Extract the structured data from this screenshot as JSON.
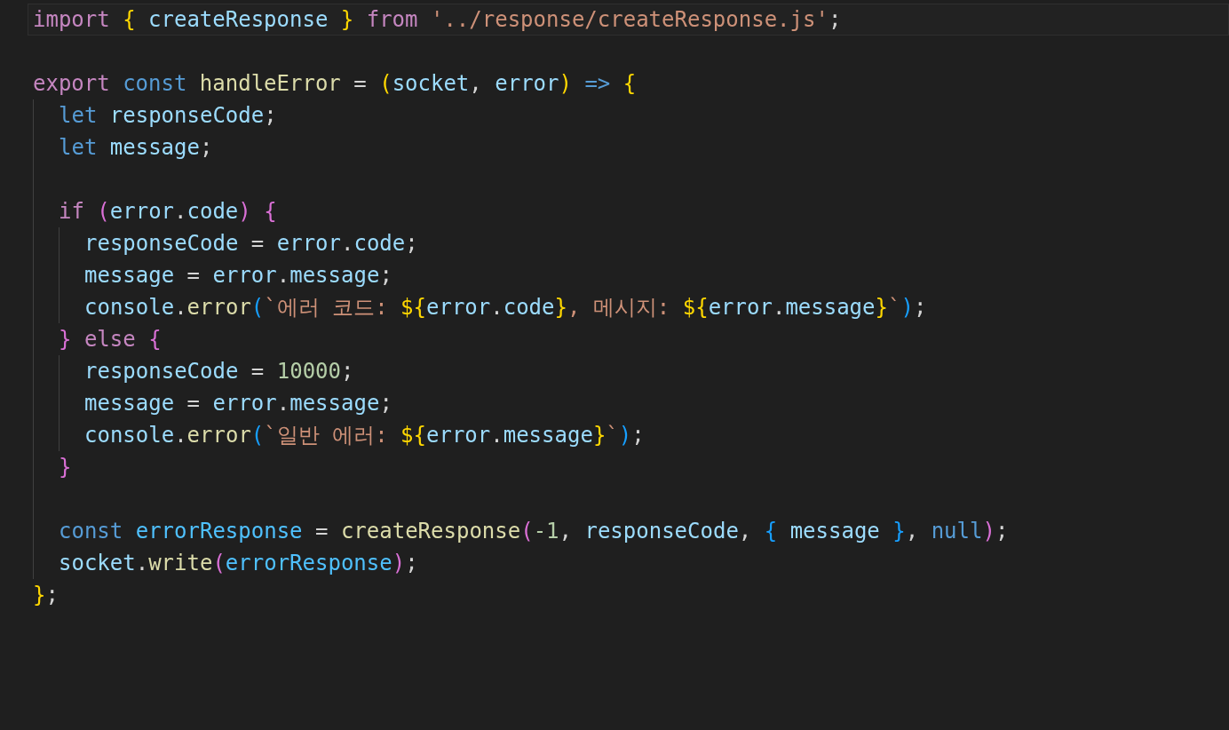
{
  "editor": {
    "lines": [
      {
        "kind": "code",
        "current": true,
        "tokens": [
          {
            "kind": "kw",
            "text": "import "
          },
          {
            "kind": "br1",
            "text": "{ "
          },
          {
            "kind": "var",
            "text": "createResponse "
          },
          {
            "kind": "br1",
            "text": "} "
          },
          {
            "kind": "kw",
            "text": "from "
          },
          {
            "kind": "str",
            "text": "'../response/createResponse.js'"
          },
          {
            "kind": "punc",
            "text": ";"
          }
        ]
      },
      {
        "kind": "blank",
        "current": false
      },
      {
        "kind": "code",
        "current": false,
        "tokens": [
          {
            "kind": "kw",
            "text": "export "
          },
          {
            "kind": "storage",
            "text": "const "
          },
          {
            "kind": "func",
            "text": "handleError"
          },
          {
            "kind": "punc",
            "text": " = "
          },
          {
            "kind": "br1",
            "text": "("
          },
          {
            "kind": "var",
            "text": "socket"
          },
          {
            "kind": "punc",
            "text": ", "
          },
          {
            "kind": "var",
            "text": "error"
          },
          {
            "kind": "br1",
            "text": ") "
          },
          {
            "kind": "storage",
            "text": "=> "
          },
          {
            "kind": "br1",
            "text": "{"
          }
        ],
        "children": [
          {
            "kind": "code",
            "current": false,
            "tokens": [
              {
                "kind": "storage",
                "text": "let "
              },
              {
                "kind": "var",
                "text": "responseCode"
              },
              {
                "kind": "punc",
                "text": ";"
              }
            ]
          },
          {
            "kind": "code",
            "current": false,
            "tokens": [
              {
                "kind": "storage",
                "text": "let "
              },
              {
                "kind": "var",
                "text": "message"
              },
              {
                "kind": "punc",
                "text": ";"
              }
            ]
          },
          {
            "kind": "blank",
            "current": false
          },
          {
            "kind": "code",
            "current": false,
            "tokens": [
              {
                "kind": "kw",
                "text": "if "
              },
              {
                "kind": "br2",
                "text": "("
              },
              {
                "kind": "var",
                "text": "error"
              },
              {
                "kind": "punc",
                "text": "."
              },
              {
                "kind": "var",
                "text": "code"
              },
              {
                "kind": "br2",
                "text": ") "
              },
              {
                "kind": "br2",
                "text": "{"
              }
            ],
            "children": [
              {
                "kind": "code",
                "current": false,
                "tokens": [
                  {
                    "kind": "var",
                    "text": "responseCode"
                  },
                  {
                    "kind": "punc",
                    "text": " = "
                  },
                  {
                    "kind": "var",
                    "text": "error"
                  },
                  {
                    "kind": "punc",
                    "text": "."
                  },
                  {
                    "kind": "var",
                    "text": "code"
                  },
                  {
                    "kind": "punc",
                    "text": ";"
                  }
                ]
              },
              {
                "kind": "code",
                "current": false,
                "tokens": [
                  {
                    "kind": "var",
                    "text": "message"
                  },
                  {
                    "kind": "punc",
                    "text": " = "
                  },
                  {
                    "kind": "var",
                    "text": "error"
                  },
                  {
                    "kind": "punc",
                    "text": "."
                  },
                  {
                    "kind": "var",
                    "text": "message"
                  },
                  {
                    "kind": "punc",
                    "text": ";"
                  }
                ]
              },
              {
                "kind": "code",
                "current": false,
                "tokens": [
                  {
                    "kind": "var",
                    "text": "console"
                  },
                  {
                    "kind": "punc",
                    "text": "."
                  },
                  {
                    "kind": "func",
                    "text": "error"
                  },
                  {
                    "kind": "br3",
                    "text": "("
                  },
                  {
                    "kind": "str",
                    "text": "`에러 코드: "
                  },
                  {
                    "kind": "br1",
                    "text": "${"
                  },
                  {
                    "kind": "var",
                    "text": "error"
                  },
                  {
                    "kind": "punc",
                    "text": "."
                  },
                  {
                    "kind": "var",
                    "text": "code"
                  },
                  {
                    "kind": "br1",
                    "text": "}"
                  },
                  {
                    "kind": "str",
                    "text": ", 메시지: "
                  },
                  {
                    "kind": "br1",
                    "text": "${"
                  },
                  {
                    "kind": "var",
                    "text": "error"
                  },
                  {
                    "kind": "punc",
                    "text": "."
                  },
                  {
                    "kind": "var",
                    "text": "message"
                  },
                  {
                    "kind": "br1",
                    "text": "}"
                  },
                  {
                    "kind": "str",
                    "text": "`"
                  },
                  {
                    "kind": "br3",
                    "text": ")"
                  },
                  {
                    "kind": "punc",
                    "text": ";"
                  }
                ]
              }
            ]
          },
          {
            "kind": "code",
            "current": false,
            "tokens": [
              {
                "kind": "br2",
                "text": "} "
              },
              {
                "kind": "kw",
                "text": "else "
              },
              {
                "kind": "br2",
                "text": "{"
              }
            ],
            "children": [
              {
                "kind": "code",
                "current": false,
                "tokens": [
                  {
                    "kind": "var",
                    "text": "responseCode"
                  },
                  {
                    "kind": "punc",
                    "text": " = "
                  },
                  {
                    "kind": "num",
                    "text": "10000"
                  },
                  {
                    "kind": "punc",
                    "text": ";"
                  }
                ]
              },
              {
                "kind": "code",
                "current": false,
                "tokens": [
                  {
                    "kind": "var",
                    "text": "message"
                  },
                  {
                    "kind": "punc",
                    "text": " = "
                  },
                  {
                    "kind": "var",
                    "text": "error"
                  },
                  {
                    "kind": "punc",
                    "text": "."
                  },
                  {
                    "kind": "var",
                    "text": "message"
                  },
                  {
                    "kind": "punc",
                    "text": ";"
                  }
                ]
              },
              {
                "kind": "code",
                "current": false,
                "tokens": [
                  {
                    "kind": "var",
                    "text": "console"
                  },
                  {
                    "kind": "punc",
                    "text": "."
                  },
                  {
                    "kind": "func",
                    "text": "error"
                  },
                  {
                    "kind": "br3",
                    "text": "("
                  },
                  {
                    "kind": "str",
                    "text": "`일반 에러: "
                  },
                  {
                    "kind": "br1",
                    "text": "${"
                  },
                  {
                    "kind": "var",
                    "text": "error"
                  },
                  {
                    "kind": "punc",
                    "text": "."
                  },
                  {
                    "kind": "var",
                    "text": "message"
                  },
                  {
                    "kind": "br1",
                    "text": "}"
                  },
                  {
                    "kind": "str",
                    "text": "`"
                  },
                  {
                    "kind": "br3",
                    "text": ")"
                  },
                  {
                    "kind": "punc",
                    "text": ";"
                  }
                ]
              }
            ]
          },
          {
            "kind": "code",
            "current": false,
            "tokens": [
              {
                "kind": "br2",
                "text": "}"
              }
            ]
          },
          {
            "kind": "blank",
            "current": false
          },
          {
            "kind": "code",
            "current": false,
            "tokens": [
              {
                "kind": "storage",
                "text": "const "
              },
              {
                "kind": "const",
                "text": "errorResponse"
              },
              {
                "kind": "punc",
                "text": " = "
              },
              {
                "kind": "func",
                "text": "createResponse"
              },
              {
                "kind": "br2",
                "text": "("
              },
              {
                "kind": "num",
                "text": "-1"
              },
              {
                "kind": "punc",
                "text": ", "
              },
              {
                "kind": "var",
                "text": "responseCode"
              },
              {
                "kind": "punc",
                "text": ", "
              },
              {
                "kind": "br3",
                "text": "{ "
              },
              {
                "kind": "var",
                "text": "message "
              },
              {
                "kind": "br3",
                "text": "}"
              },
              {
                "kind": "punc",
                "text": ", "
              },
              {
                "kind": "storage",
                "text": "null"
              },
              {
                "kind": "br2",
                "text": ")"
              },
              {
                "kind": "punc",
                "text": ";"
              }
            ]
          },
          {
            "kind": "code",
            "current": false,
            "tokens": [
              {
                "kind": "var",
                "text": "socket"
              },
              {
                "kind": "punc",
                "text": "."
              },
              {
                "kind": "func",
                "text": "write"
              },
              {
                "kind": "br2",
                "text": "("
              },
              {
                "kind": "const",
                "text": "errorResponse"
              },
              {
                "kind": "br2",
                "text": ")"
              },
              {
                "kind": "punc",
                "text": ";"
              }
            ]
          }
        ]
      },
      {
        "kind": "code",
        "current": false,
        "tokens": [
          {
            "kind": "br1",
            "text": "}"
          },
          {
            "kind": "punc",
            "text": ";"
          }
        ]
      }
    ]
  }
}
